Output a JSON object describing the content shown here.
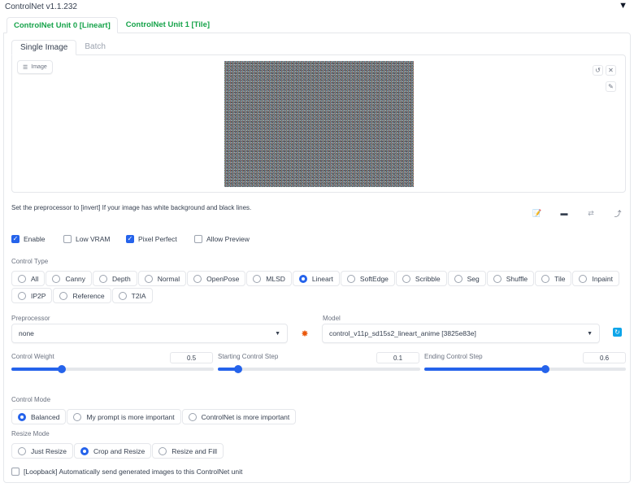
{
  "header": {
    "title": "ControlNet v1.1.232"
  },
  "unit_tabs": [
    {
      "label": "ControlNet Unit 0 [Lineart]",
      "active": true
    },
    {
      "label": "ControlNet Unit 1 [Tile]",
      "active": false
    }
  ],
  "image_tabs": [
    {
      "label": "Single Image",
      "active": true
    },
    {
      "label": "Batch",
      "active": false
    }
  ],
  "image_input": {
    "label": "Image"
  },
  "hint": "Set the preprocessor to [invert] If your image has white background and black lines.",
  "checkboxes": {
    "enable": {
      "label": "Enable",
      "checked": true
    },
    "low_vram": {
      "label": "Low VRAM",
      "checked": false
    },
    "pixel_perfect": {
      "label": "Pixel Perfect",
      "checked": true
    },
    "allow_preview": {
      "label": "Allow Preview",
      "checked": false
    }
  },
  "control_type": {
    "label": "Control Type",
    "options": [
      "All",
      "Canny",
      "Depth",
      "Normal",
      "OpenPose",
      "MLSD",
      "Lineart",
      "SoftEdge",
      "Scribble",
      "Seg",
      "Shuffle",
      "Tile",
      "Inpaint",
      "IP2P",
      "Reference",
      "T2IA"
    ],
    "selected": "Lineart"
  },
  "preprocessor": {
    "label": "Preprocessor",
    "value": "none"
  },
  "model": {
    "label": "Model",
    "value": "control_v11p_sd15s2_lineart_anime [3825e83e]"
  },
  "sliders": {
    "control_weight": {
      "label": "Control Weight",
      "value": "0.5",
      "fraction": 0.25
    },
    "start_step": {
      "label": "Starting Control Step",
      "value": "0.1",
      "fraction": 0.1
    },
    "end_step": {
      "label": "Ending Control Step",
      "value": "0.6",
      "fraction": 0.6
    }
  },
  "control_mode": {
    "label": "Control Mode",
    "options": [
      "Balanced",
      "My prompt is more important",
      "ControlNet is more important"
    ],
    "selected": "Balanced"
  },
  "resize_mode": {
    "label": "Resize Mode",
    "options": [
      "Just Resize",
      "Crop and Resize",
      "Resize and Fill"
    ],
    "selected": "Crop and Resize"
  },
  "loopback": {
    "label": "[Loopback] Automatically send generated images to this ControlNet unit",
    "checked": false
  },
  "colors": {
    "accent": "#2563eb",
    "tab_green": "#16a34a",
    "border": "#e5e7eb"
  },
  "icons": [
    "collapse-arrow-icon",
    "image-icon",
    "undo-icon",
    "close-icon",
    "brush-icon",
    "edit-icon",
    "camera-icon",
    "swap-icon",
    "send-icon",
    "explosion-icon",
    "refresh-icon"
  ]
}
